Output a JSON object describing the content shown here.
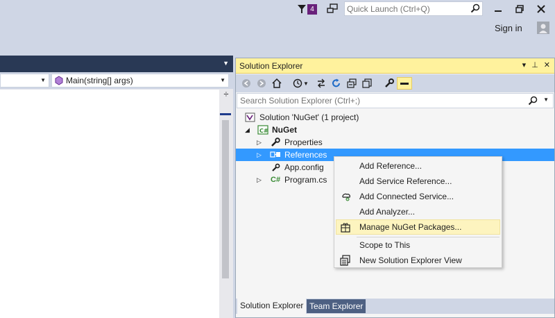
{
  "titlebar": {
    "notifications_count": "4",
    "quick_launch_placeholder": "Quick Launch (Ctrl+Q)",
    "sign_in": "Sign in"
  },
  "editor": {
    "member_dropdown": "Main(string[] args)"
  },
  "solution_explorer": {
    "title": "Solution Explorer",
    "search_placeholder": "Search Solution Explorer (Ctrl+;)",
    "tree": {
      "solution": "Solution 'NuGet' (1 project)",
      "project": "NuGet",
      "properties": "Properties",
      "references": "References",
      "app_config": "App.config",
      "program_cs": "Program.cs"
    },
    "tabs": {
      "solution_explorer": "Solution Explorer",
      "team_explorer": "Team Explorer"
    }
  },
  "context_menu": {
    "add_reference": "Add Reference...",
    "add_service_reference": "Add Service Reference...",
    "add_connected_service": "Add Connected Service...",
    "add_analyzer": "Add Analyzer...",
    "manage_nuget": "Manage NuGet Packages...",
    "scope_to_this": "Scope to This",
    "new_se_view": "New Solution Explorer View"
  },
  "colors": {
    "chrome": "#cfd6e5",
    "title_active": "#fff29d",
    "selection": "#3399ff",
    "menu_highlight": "#fdf4bf",
    "csharp_green": "#388a34",
    "badge_purple": "#68217a"
  }
}
